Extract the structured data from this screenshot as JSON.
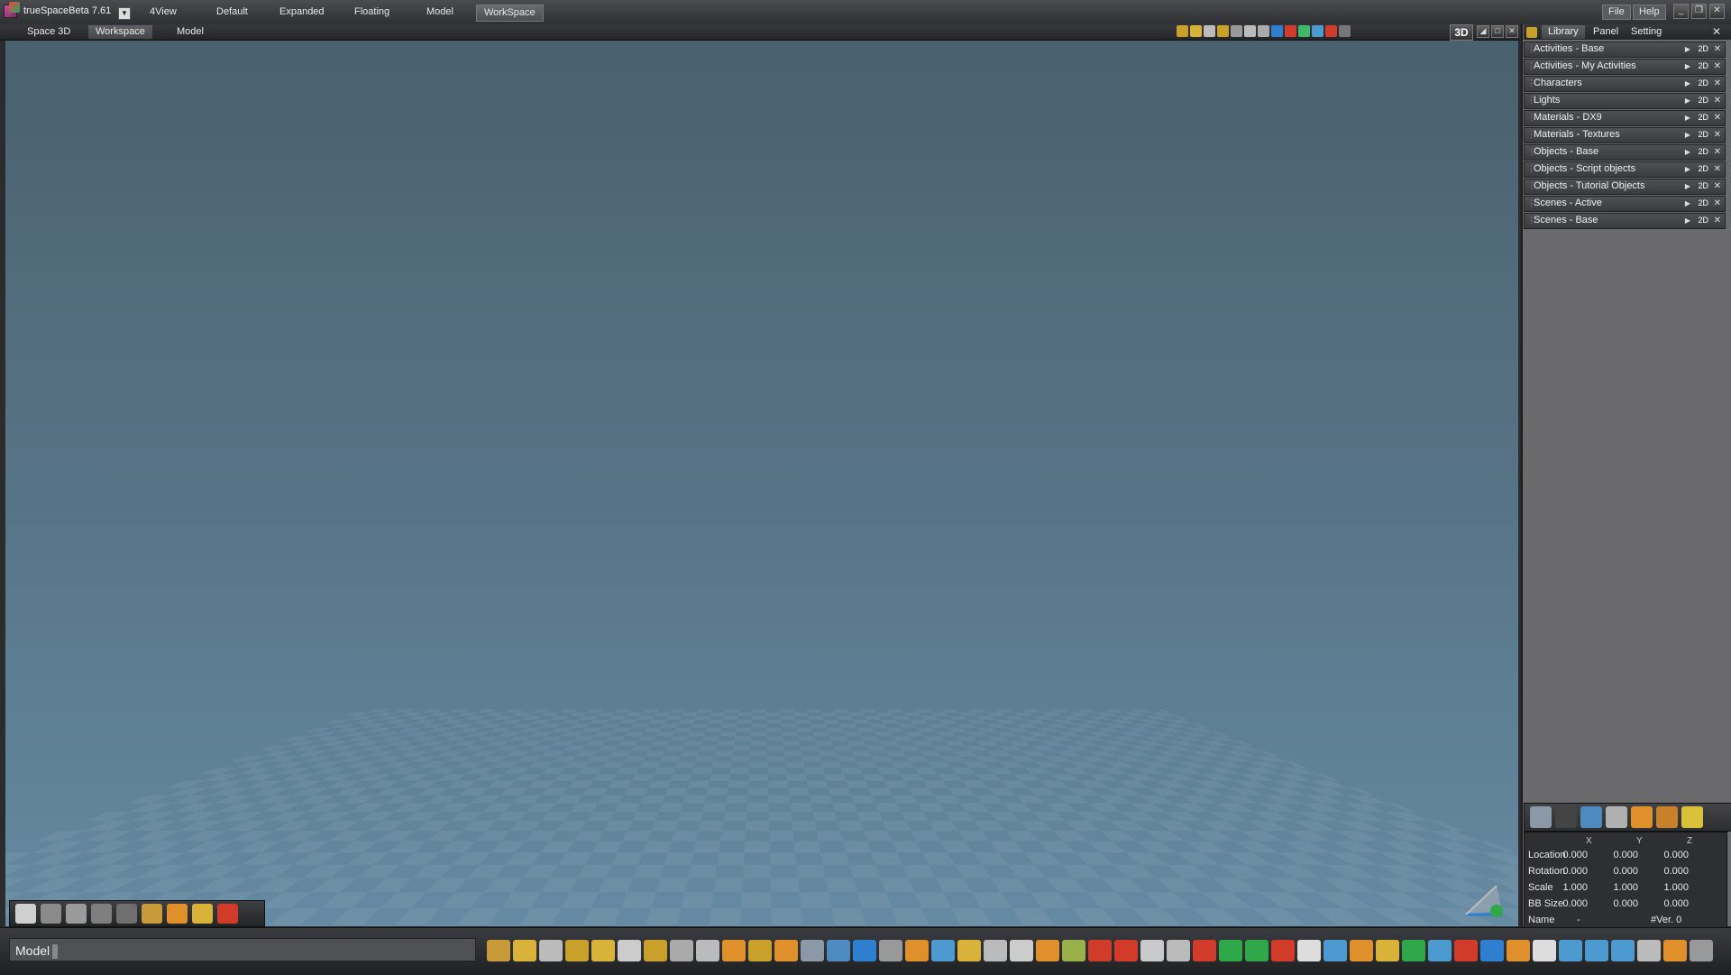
{
  "app": {
    "title": "trueSpaceBeta 7.61",
    "layouts": [
      "4View",
      "Default",
      "Expanded",
      "Floating",
      "Model",
      "WorkSpace"
    ],
    "active_layout": "WorkSpace",
    "menu": {
      "file": "File",
      "help": "Help"
    }
  },
  "viewport": {
    "title": "Space 3D",
    "tabs": [
      "Workspace",
      "Model"
    ],
    "active_tab": "Workspace",
    "mode": "3D"
  },
  "right_panel": {
    "tabs": [
      "Library",
      "Panel",
      "Setting"
    ],
    "active_tab": "Library",
    "library_items": [
      "Activities - Base",
      "Activities - My Activities",
      "Characters",
      "Lights",
      "Materials - DX9",
      "Materials - Textures",
      "Objects - Base",
      "Objects - Script objects",
      "Objects - Tutorial Objects",
      "Scenes - Active",
      "Scenes - Base"
    ],
    "item_badge": "2D",
    "properties": {
      "headers": [
        "X",
        "Y",
        "Z"
      ],
      "rows": [
        {
          "label": "Location",
          "values": [
            "0.000",
            "0.000",
            "0.000"
          ]
        },
        {
          "label": "Rotation",
          "values": [
            "0.000",
            "0.000",
            "0.000"
          ]
        },
        {
          "label": "Scale",
          "values": [
            "1.000",
            "1.000",
            "1.000"
          ]
        },
        {
          "label": "BB Size",
          "values": [
            "0.000",
            "0.000",
            "0.000"
          ]
        }
      ],
      "name_label": "Name",
      "name_value": "-",
      "ver_value": "#Ver. 0"
    }
  },
  "status": {
    "command_text": "Model"
  },
  "colors": {
    "accent_red": "#d23a2a",
    "accent_orange": "#e0902a",
    "accent_blue": "#2e7fd0",
    "accent_green": "#2fa84a"
  }
}
